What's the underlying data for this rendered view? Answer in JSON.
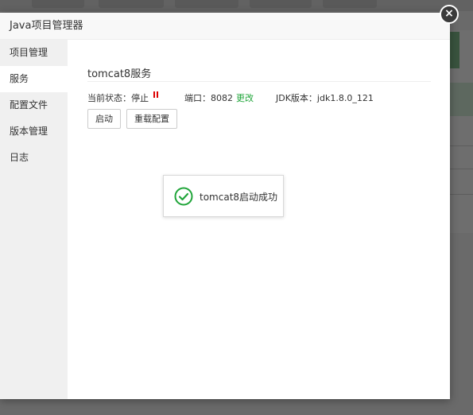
{
  "window": {
    "title": "Java项目管理器",
    "close_symbol": "×"
  },
  "sidebar": {
    "items": [
      {
        "label": "项目管理",
        "active": false
      },
      {
        "label": "服务",
        "active": true
      },
      {
        "label": "配置文件",
        "active": false
      },
      {
        "label": "版本管理",
        "active": false
      },
      {
        "label": "日志",
        "active": false
      }
    ]
  },
  "service": {
    "title": "tomcat8服务",
    "status_label": "当前状态：停止",
    "status_color": "#dd0000",
    "port_label": "端口：8082",
    "port_change_link": "更改",
    "jdk_label": "JDK版本：jdk1.8.0_121",
    "start_button": "启动",
    "reload_button": "重载配置"
  },
  "toast": {
    "message": "tomcat8启动成功",
    "icon": "check-circle-icon",
    "icon_color": "#20a53a"
  }
}
